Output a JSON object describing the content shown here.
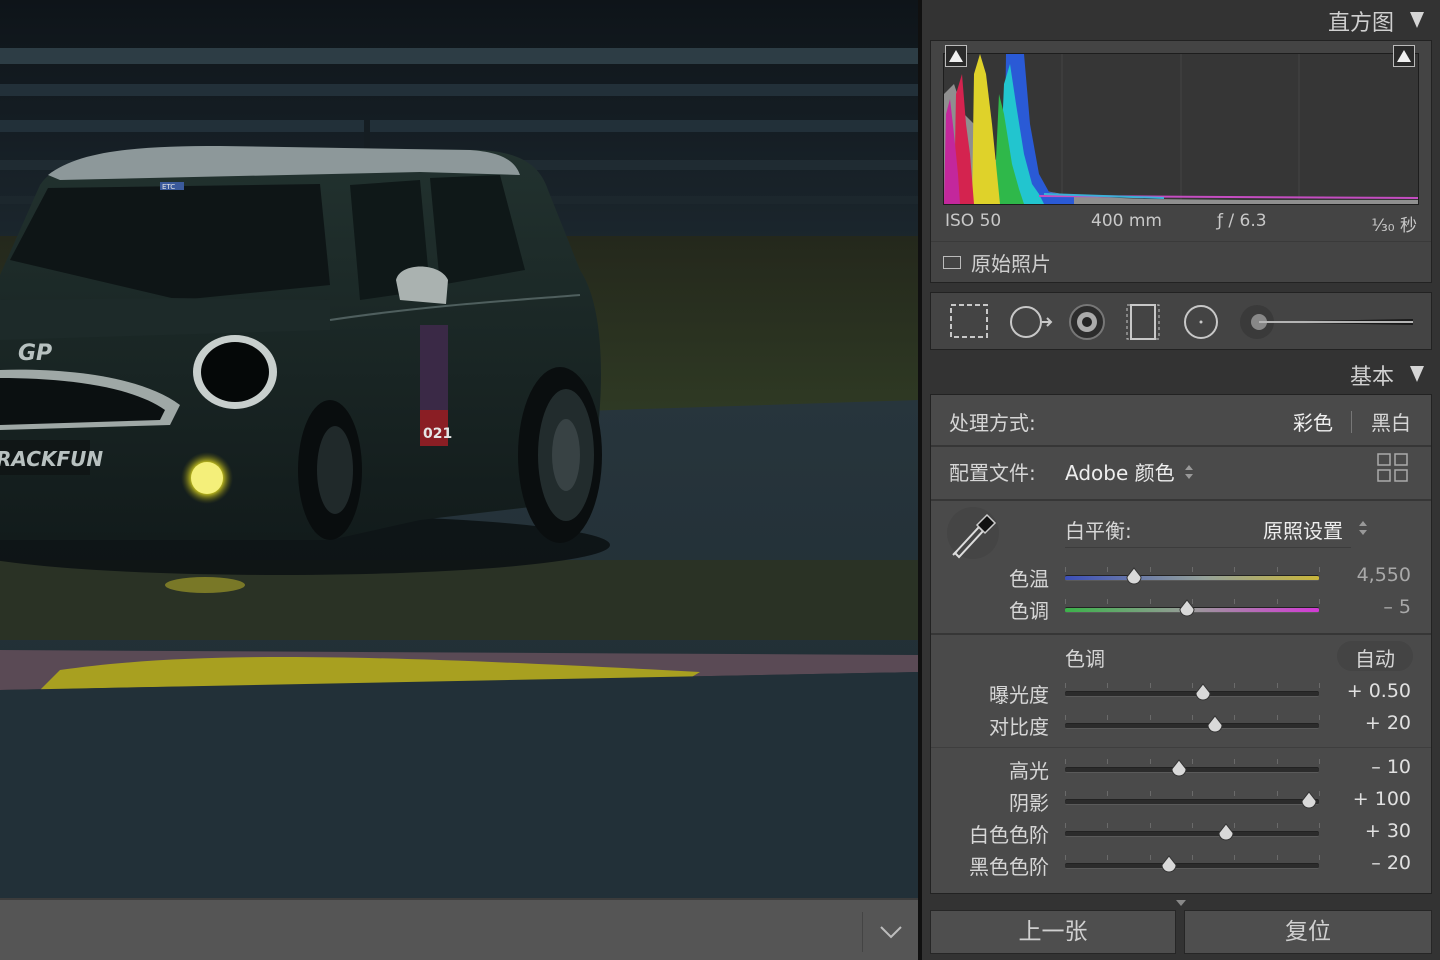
{
  "histogram_panel": {
    "title": "直方图"
  },
  "exif": {
    "iso": "ISO 50",
    "focal": "400 mm",
    "aperture": "ƒ / 6.3",
    "shutter": "¹⁄₃₀ 秒"
  },
  "original_photo": {
    "label": "原始照片",
    "checked": false
  },
  "basic_panel": {
    "title": "基本",
    "treatment_label": "处理方式:",
    "treatment_color": "彩色",
    "treatment_bw": "黑白",
    "profile_label": "配置文件:",
    "profile_value": "Adobe 颜色",
    "wb_label": "白平衡:",
    "wb_value": "原照设置",
    "tone_label": "色调",
    "auto_label": "自动"
  },
  "sliders": {
    "temp": {
      "label": "色温",
      "value": "4,550",
      "pos": 0.27
    },
    "tint": {
      "label": "色调",
      "value": "– 5",
      "pos": 0.48
    },
    "exposure": {
      "label": "曝光度",
      "value": "+ 0.50",
      "pos": 0.545
    },
    "contrast": {
      "label": "对比度",
      "value": "+ 20",
      "pos": 0.59
    },
    "highlights": {
      "label": "高光",
      "value": "– 10",
      "pos": 0.45
    },
    "shadows": {
      "label": "阴影",
      "value": "+ 100",
      "pos": 0.96
    },
    "whites": {
      "label": "白色色阶",
      "value": "+ 30",
      "pos": 0.635
    },
    "blacks": {
      "label": "黑色色阶",
      "value": "– 20",
      "pos": 0.41
    }
  },
  "footer": {
    "prev_label": "上一张",
    "reset_label": "复位"
  },
  "preview_text": {
    "plate": "RACKFUN",
    "logo": "GP",
    "race_number": "021",
    "windshield": "ETC"
  }
}
